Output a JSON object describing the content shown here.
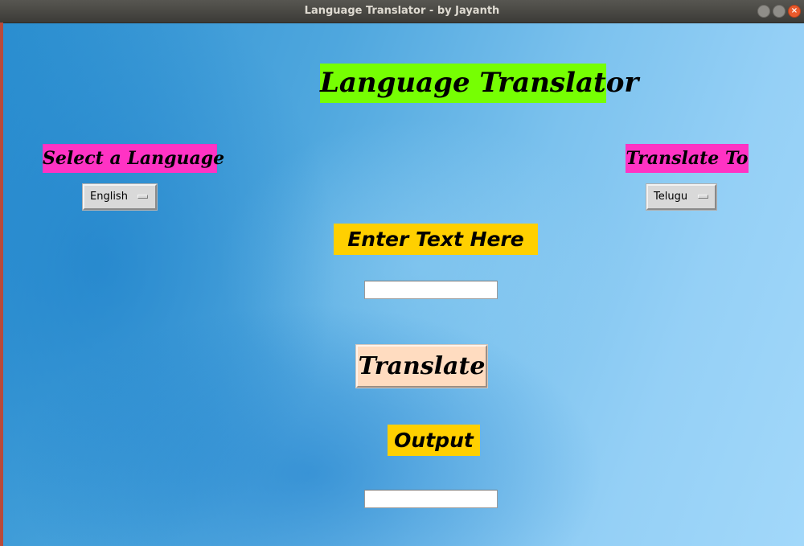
{
  "window": {
    "title": "Language Translator - by Jayanth",
    "controls": {
      "minimize_icon": "minimize-icon",
      "maximize_icon": "maximize-icon",
      "close_icon": "close-icon",
      "close_glyph": "×"
    }
  },
  "app": {
    "heading": "Language Translator",
    "source": {
      "label": "Select a Language",
      "selected": "English"
    },
    "target": {
      "label": "Translate To",
      "selected": "Telugu"
    },
    "input": {
      "label": "Enter Text Here",
      "value": ""
    },
    "translate_button": "Translate",
    "output": {
      "label": "Output",
      "value": ""
    }
  },
  "colors": {
    "heading_bg": "#76ff03",
    "language_label_bg": "#ff33c4",
    "io_label_bg": "#ffd000",
    "button_bg": "#ffdcc0",
    "titlebar_bg": "#3c3b37",
    "close_button": "#ea5a2c"
  }
}
